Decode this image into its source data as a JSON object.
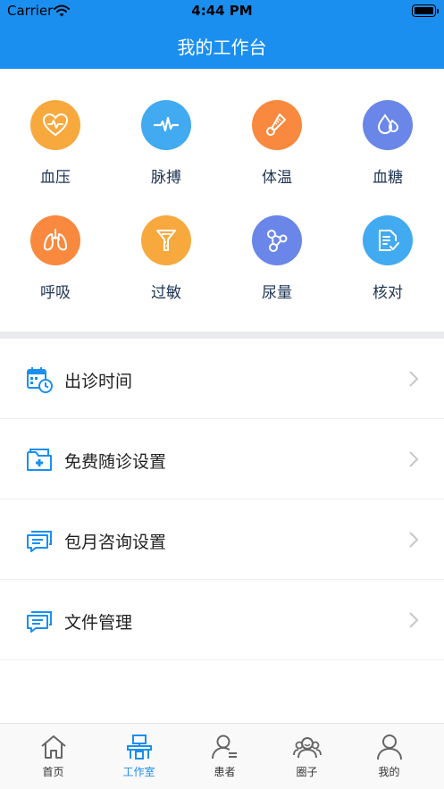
{
  "status_bar": {
    "carrier": "Carrier",
    "time": "4:44 PM"
  },
  "nav": {
    "title": "我的工作台"
  },
  "grid": {
    "items": [
      {
        "label": "血压",
        "icon": "heart-pulse-icon",
        "color": "#f7a93e"
      },
      {
        "label": "脉搏",
        "icon": "pulse-wave-icon",
        "color": "#41aaf0"
      },
      {
        "label": "体温",
        "icon": "thermometer-icon",
        "color": "#f8893e"
      },
      {
        "label": "血糖",
        "icon": "blood-drop-icon",
        "color": "#6a86e8"
      },
      {
        "label": "呼吸",
        "icon": "lungs-icon",
        "color": "#f8893e"
      },
      {
        "label": "过敏",
        "icon": "allergy-icon",
        "color": "#f7a93e"
      },
      {
        "label": "尿量",
        "icon": "molecule-icon",
        "color": "#6a86e8"
      },
      {
        "label": "核对",
        "icon": "check-document-icon",
        "color": "#41aaf0"
      }
    ]
  },
  "menu": {
    "items": [
      {
        "label": "出诊时间",
        "icon": "calendar-clock-icon"
      },
      {
        "label": "免费随诊设置",
        "icon": "medical-folder-icon"
      },
      {
        "label": "包月咨询设置",
        "icon": "chat-bubbles-icon"
      },
      {
        "label": "文件管理",
        "icon": "chat-bubbles-icon"
      }
    ]
  },
  "tabbar": {
    "active_color": "#1a8ff0",
    "items": [
      {
        "label": "首页",
        "icon": "home-icon"
      },
      {
        "label": "工作室",
        "icon": "workstation-icon"
      },
      {
        "label": "患者",
        "icon": "patient-icon"
      },
      {
        "label": "圈子",
        "icon": "group-icon"
      },
      {
        "label": "我的",
        "icon": "profile-icon"
      }
    ]
  }
}
